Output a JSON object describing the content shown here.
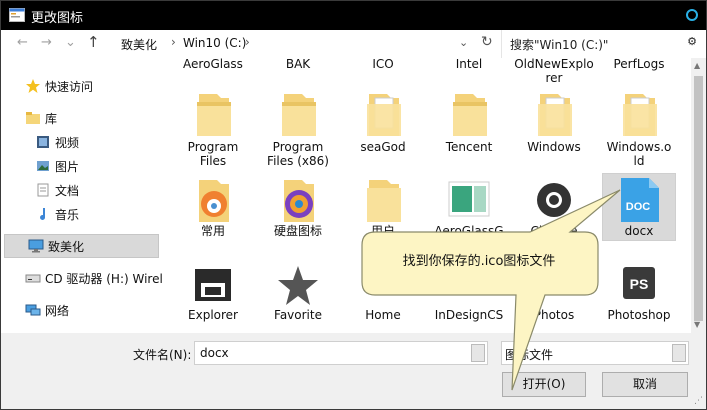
{
  "window": {
    "title": "更改图标"
  },
  "nav": {
    "back": "←",
    "forward": "→",
    "down": "⌄",
    "up": "↑"
  },
  "address": {
    "crumbs": [
      "致美化",
      "Win10 (C:)"
    ],
    "sep": "›",
    "dropdown": "⌄",
    "refresh": "↻"
  },
  "search": {
    "placeholder": "搜索\"Win10 (C:)\"",
    "icon": "⚙"
  },
  "sidebar": {
    "items": [
      {
        "label": "快速访问",
        "icon": "star-icon"
      },
      {
        "label": "库",
        "icon": "library-folder-icon"
      },
      {
        "label": "视频",
        "icon": "video-icon"
      },
      {
        "label": "图片",
        "icon": "pictures-icon"
      },
      {
        "label": "文档",
        "icon": "document-icon"
      },
      {
        "label": "音乐",
        "icon": "music-icon"
      },
      {
        "label": "致美化",
        "icon": "computer-icon"
      },
      {
        "label": "CD 驱动器 (H:) Wirel",
        "icon": "cd-drive-icon"
      },
      {
        "label": "网络",
        "icon": "network-icon"
      }
    ]
  },
  "files": {
    "top_row": [
      "AeroGlass",
      "BAK",
      "ICO",
      "Intel",
      "OldNewExplorer",
      "PerfLogs"
    ],
    "row1": [
      {
        "name": "Program Files",
        "l1": "Program",
        "l2": "Files"
      },
      {
        "name": "Program Files (x86)",
        "l1": "Program",
        "l2": "Files (x86)"
      },
      {
        "name": "seaGod",
        "l1": "seaGod",
        "l2": ""
      },
      {
        "name": "Tencent",
        "l1": "Tencent",
        "l2": ""
      },
      {
        "name": "Windows",
        "l1": "Windows",
        "l2": ""
      },
      {
        "name": "Windows.old",
        "l1": "Windows.o",
        "l2": "ld"
      }
    ],
    "row2": [
      "常用",
      "硬盘图标",
      "用户",
      "AeroGlassG",
      "Chrome",
      "docx"
    ],
    "row3": [
      "Explorer",
      "Favorite",
      "Home",
      "InDesignCS",
      "Photos",
      "Photoshop"
    ],
    "docx_badge": "DOC",
    "ps_badge": "PS"
  },
  "bottom": {
    "filename_label": "文件名(N):",
    "filename_value": "docx",
    "filetype_value": "图标文件",
    "open_button": "打开(O)",
    "cancel_button": "取消"
  },
  "callout": {
    "text": "找到你保存的.ico图标文件"
  },
  "colors": {
    "titlebar": "#000000",
    "accent": "#29b0e6",
    "callout_fill": "#fdf5c4",
    "callout_border": "#8a8a6a"
  }
}
